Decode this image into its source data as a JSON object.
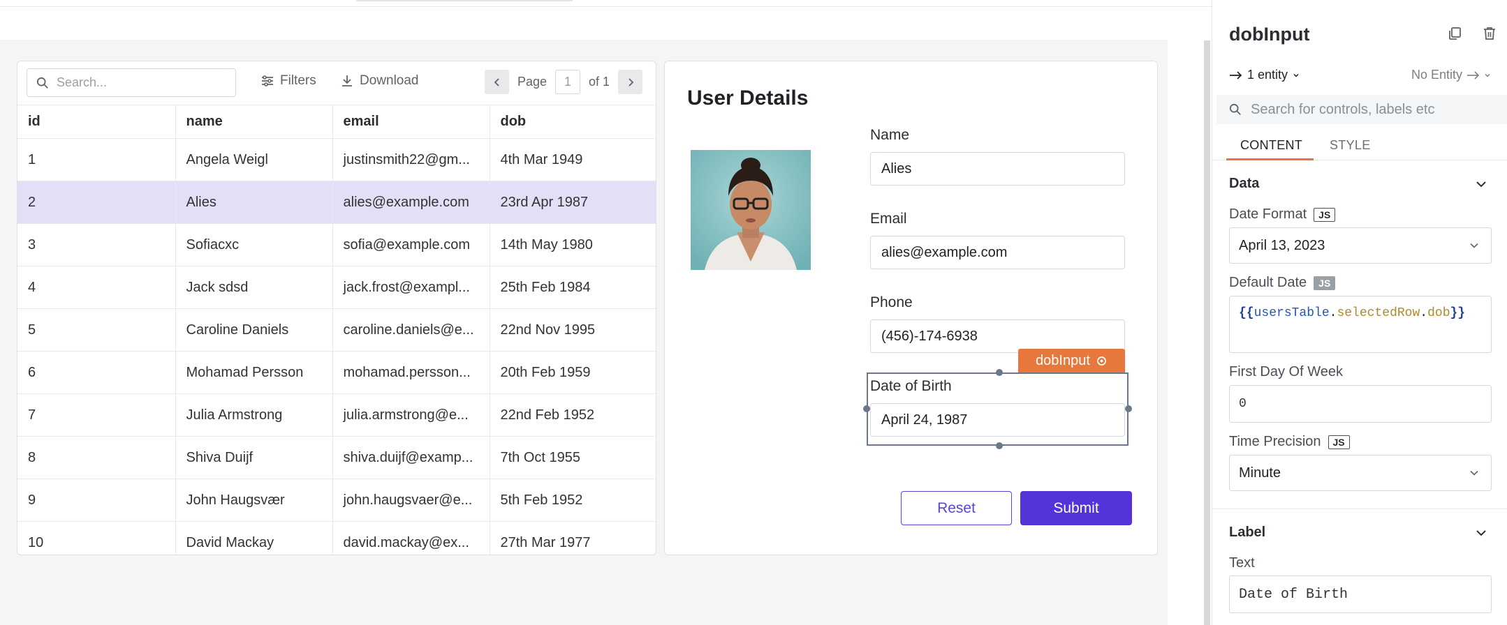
{
  "table": {
    "search_placeholder": "Search...",
    "filters_label": "Filters",
    "download_label": "Download",
    "page_label": "Page",
    "page_number": "1",
    "page_of": "of 1",
    "columns": [
      "id",
      "name",
      "email",
      "dob"
    ],
    "rows": [
      [
        "1",
        "Angela Weigl",
        "justinsmith22@gm...",
        "4th Mar 1949"
      ],
      [
        "2",
        "Alies",
        "alies@example.com",
        "23rd Apr 1987"
      ],
      [
        "3",
        "Sofiacxc",
        "sofia@example.com",
        "14th May 1980"
      ],
      [
        "4",
        "Jack sdsd",
        "jack.frost@exampl...",
        "25th Feb 1984"
      ],
      [
        "5",
        "Caroline Daniels",
        "caroline.daniels@e...",
        "22nd Nov 1995"
      ],
      [
        "6",
        "Mohamad Persson",
        "mohamad.persson...",
        "20th Feb 1959"
      ],
      [
        "7",
        "Julia Armstrong",
        "julia.armstrong@e...",
        "22nd Feb 1952"
      ],
      [
        "8",
        "Shiva Duijf",
        "shiva.duijf@examp...",
        "7th Oct 1955"
      ],
      [
        "9",
        "John Haugsvær",
        "john.haugsvaer@e...",
        "5th Feb 1952"
      ],
      [
        "10",
        "David Mackay",
        "david.mackay@ex...",
        "27th Mar 1977"
      ]
    ],
    "selected_row_index": 1,
    "colors": {
      "selected_row": "#e2e0f7"
    }
  },
  "form": {
    "title": "User Details",
    "name_label": "Name",
    "name_value": "Alies",
    "email_label": "Email",
    "email_value": "alies@example.com",
    "phone_label": "Phone",
    "phone_value": "(456)-174-6938",
    "dob_label": "Date of Birth",
    "dob_value": "April 24, 1987",
    "widget_tag": "dobInput",
    "reset_label": "Reset",
    "submit_label": "Submit",
    "colors": {
      "accent": "#5433d8",
      "tag": "#e8773c"
    }
  },
  "pane": {
    "title": "dobInput",
    "entity_left": "1 entity",
    "entity_right": "No Entity",
    "search_placeholder": "Search for controls, labels etc",
    "tabs": [
      "CONTENT",
      "STYLE"
    ],
    "data_section": "Data",
    "date_format_label": "Date Format",
    "js_badge": "JS",
    "date_format_value": "April 13, 2023",
    "default_date_label": "Default Date",
    "default_date_code": {
      "open": "{{",
      "object": "usersTable",
      "dot1": ".",
      "prop1": "selectedRow",
      "dot2": ".",
      "prop2": "dob",
      "close": "}}"
    },
    "first_day_label": "First Day Of Week",
    "first_day_value": "0",
    "time_precision_label": "Time Precision",
    "time_precision_value": "Minute",
    "label_section": "Label",
    "text_label": "Text",
    "text_value": "Date of Birth"
  }
}
